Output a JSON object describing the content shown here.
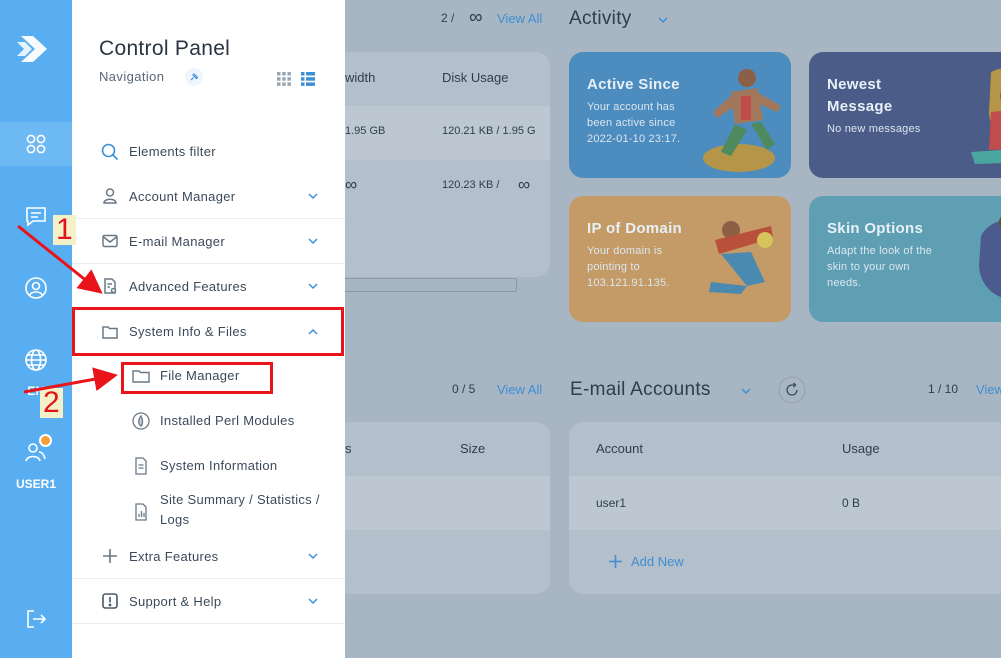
{
  "rail": {
    "language": "EN",
    "user": "USER1",
    "icons": [
      "logo-icon",
      "dashboard-icon",
      "messages-icon",
      "account-icon",
      "globe-icon",
      "users-icon",
      "logout-icon"
    ],
    "accent": "#58aef0",
    "badge_color": "#f59e3a"
  },
  "nav": {
    "title": "Control Panel",
    "subtitle": "Navigation",
    "filter_label": "Elements filter",
    "sections": [
      {
        "label": "Account Manager",
        "icon": "user-icon"
      },
      {
        "label": "E-mail Manager",
        "icon": "envelope-icon"
      },
      {
        "label": "Advanced Features",
        "icon": "file-gear-icon"
      },
      {
        "label": "System Info & Files",
        "icon": "folder-icon",
        "expanded": true
      },
      {
        "label": "Extra Features",
        "icon": "plus-icon"
      },
      {
        "label": "Support & Help",
        "icon": "exclamation-icon"
      }
    ],
    "submenu": [
      {
        "label": "File Manager",
        "icon": "folder-icon"
      },
      {
        "label": "Installed Perl Modules",
        "icon": "perl-icon"
      },
      {
        "label": "System Information",
        "icon": "document-icon"
      },
      {
        "label": "Site Summary / Statistics /",
        "label2": "Logs",
        "icon": "stats-icon"
      }
    ]
  },
  "background": {
    "top_counter": "2  /",
    "top_infinity": "∞",
    "view_all": "View All",
    "col_bandwidth": "width",
    "col_disk": "Disk Usage",
    "row1_bandwidth": "1.95 GB",
    "row1_disk": "120.21 KB  /  1.95 G",
    "row2_bandwidth": "∞",
    "row2_disk": "120.23 KB  /",
    "row2_disk_inf": "∞",
    "activity_title": "Activity",
    "cards": [
      {
        "title": "Active Since",
        "desc": [
          "Your account has",
          "been active since",
          "2022-01-10 23:17."
        ],
        "color": "#3d8fd6"
      },
      {
        "title": "Newest",
        "title2": "Message",
        "desc": [
          "No new messages"
        ],
        "color": "#3e5a9c"
      },
      {
        "title": "IP of Domain",
        "desc": [
          "Your domain is",
          "pointing to",
          "103.121.91.135."
        ],
        "color": "#e5a45a"
      },
      {
        "title": "Skin Options",
        "desc": [
          "Adapt the look of the",
          "skin to your own",
          "needs."
        ],
        "color": "#4aa7c4"
      }
    ],
    "files_counter": "0  /  5",
    "files_view_all": "View All",
    "files_col_s": "s",
    "files_col_size": "Size",
    "email_title": "E-mail Accounts",
    "email_counter": "1  /  10",
    "email_view": "View",
    "email_col_account": "Account",
    "email_col_usage": "Usage",
    "email_row_account": "user1",
    "email_row_usage": "0 B",
    "add_new": "Add New"
  },
  "annotations": {
    "step1": "1",
    "step2": "2",
    "color": "#e8141a"
  }
}
